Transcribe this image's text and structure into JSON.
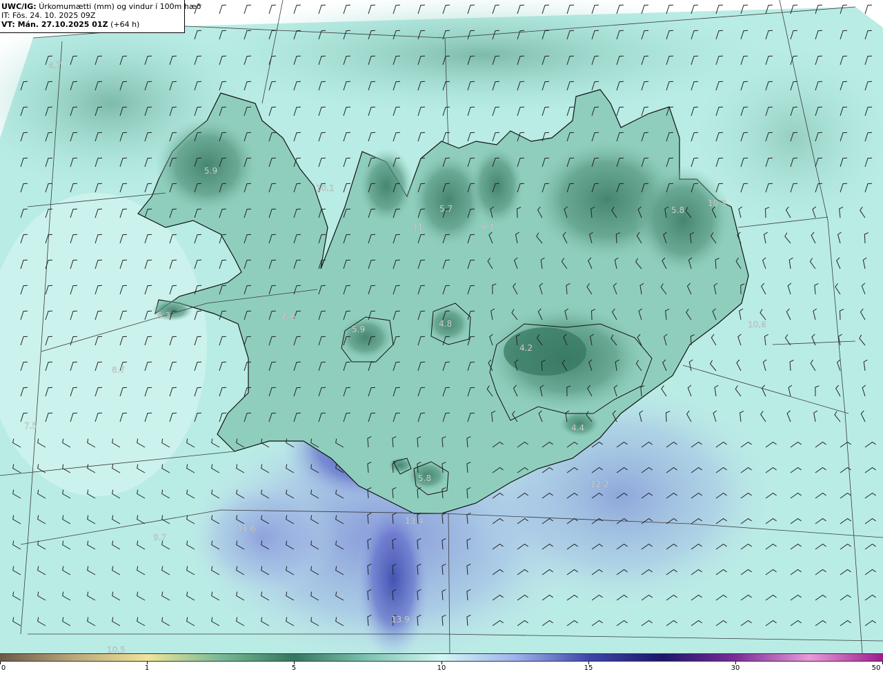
{
  "header": {
    "model": "UWC/IG:",
    "title": "Úrkomumætti (mm) og vindur í 100m hæð",
    "init_time": "IT: Fös. 24. 10. 2025 09Z",
    "valid_time": "VT: Mán. 27.10.2025 01Z",
    "lead": "(+64 h)"
  },
  "colors": {
    "land_dark": "#3e7e67",
    "land_mid": "#6fb09c",
    "sea_light": "#c9f2ee",
    "sea_mid": "#a6e6dc",
    "blue_high": "#6f79cf",
    "blue_core": "#4450b4",
    "coast": "#111111",
    "grid": "#333333",
    "label_text": "#e8e8e8"
  },
  "values": [
    {
      "text": "6.7"
    },
    {
      "text": "5.9"
    },
    {
      "text": "10.1"
    },
    {
      "text": "5.7"
    },
    {
      "text": "11"
    },
    {
      "text": "9.7"
    },
    {
      "text": "5.8"
    },
    {
      "text": "10.3"
    },
    {
      "text": "5.3"
    },
    {
      "text": "6.6"
    },
    {
      "text": "5.9"
    },
    {
      "text": "4.8"
    },
    {
      "text": "10.6"
    },
    {
      "text": "4.2"
    },
    {
      "text": "8.7"
    },
    {
      "text": "7.5"
    },
    {
      "text": "4.4"
    },
    {
      "text": "12.2"
    },
    {
      "text": "5.8"
    },
    {
      "text": "13.4"
    },
    {
      "text": "11.6"
    },
    {
      "text": "9.7"
    },
    {
      "text": "13.9"
    },
    {
      "text": "10.5"
    }
  ],
  "colorbar": {
    "ticks": [
      "0",
      "1",
      "5",
      "10",
      "15",
      "30",
      "50"
    ],
    "stops": [
      "#6b5a47",
      "#b9a77b",
      "#efe49a",
      "#79b995",
      "#35765f",
      "#7fc4b1",
      "#d3f6f3",
      "#9fb2ec",
      "#3e47a9",
      "#1d166c",
      "#7a2d97",
      "#e79ad8",
      "#9c1b8e"
    ]
  }
}
